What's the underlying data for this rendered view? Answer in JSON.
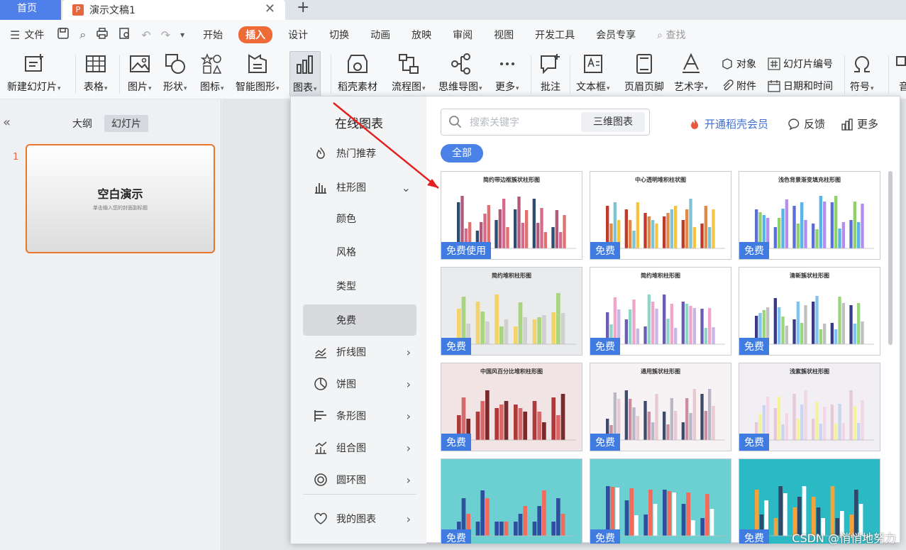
{
  "tabs": {
    "home": "首页",
    "doc": "演示文稿1",
    "close": "✕",
    "add": "+"
  },
  "menu": {
    "file": "文件",
    "items": [
      "开始",
      "插入",
      "设计",
      "切换",
      "动画",
      "放映",
      "审阅",
      "视图",
      "开发工具",
      "会员专享"
    ],
    "active": "插入",
    "search": "查找"
  },
  "ribbon": {
    "new_slide": "新建幻灯片",
    "table": "表格",
    "picture": "图片",
    "shape": "形状",
    "icon": "图标",
    "smartart": "智能图形",
    "chart": "图表",
    "material": "稻壳素材",
    "flowchart": "流程图",
    "mindmap": "思维导图",
    "more": "更多",
    "comment": "批注",
    "textbox": "文本框",
    "header_footer": "页眉页脚",
    "wordart": "艺术字",
    "object": "对象",
    "slide_number": "幻灯片编号",
    "attachment": "附件",
    "datetime": "日期和时间",
    "symbol": "符号",
    "audio": "音"
  },
  "left_pane": {
    "tab_outline": "大纲",
    "tab_slides": "幻灯片",
    "slide_number": "1",
    "slide_title": "空白演示",
    "slide_subtitle": "单击输入您的封面副标题"
  },
  "panel": {
    "title": "在线图表",
    "categories": {
      "hot": "热门推荐",
      "column": "柱形图",
      "color": "颜色",
      "style": "风格",
      "type": "类型",
      "free": "免费",
      "line": "折线图",
      "pie": "饼图",
      "bar": "条形图",
      "combo": "组合图",
      "donut": "圆环图",
      "mine": "我的图表"
    },
    "search_placeholder": "搜索关键字",
    "search_3d": "三维图表",
    "vip": "开通稻壳会员",
    "feedback": "反馈",
    "more": "更多",
    "filter_all": "全部",
    "cards": [
      {
        "title": "简约带边框簇状柱形图",
        "badge": "免费使用"
      },
      {
        "title": "中心透明堆积柱状图",
        "badge": "免费"
      },
      {
        "title": "浅色背景渐变填充柱形图",
        "badge": "免费"
      },
      {
        "title": "简约堆积柱形图",
        "badge": "免费"
      },
      {
        "title": "简约堆积柱形图",
        "badge": "免费"
      },
      {
        "title": "清新簇状柱形图",
        "badge": "免费"
      },
      {
        "title": "中国风百分比堆积柱形图",
        "badge": "免费"
      },
      {
        "title": "通用簇状柱形图",
        "badge": "免费"
      },
      {
        "title": "浅紫簇状柱形图",
        "badge": "免费"
      },
      {
        "title": "",
        "badge": "免费"
      },
      {
        "title": "",
        "badge": "免费"
      },
      {
        "title": "",
        "badge": "免费"
      }
    ]
  },
  "watermark": "CSDN @悄悄地努力",
  "colors": {
    "accent": "#4b82e8",
    "active_tab": "#ee6a37",
    "slide_border": "#e8772e"
  }
}
